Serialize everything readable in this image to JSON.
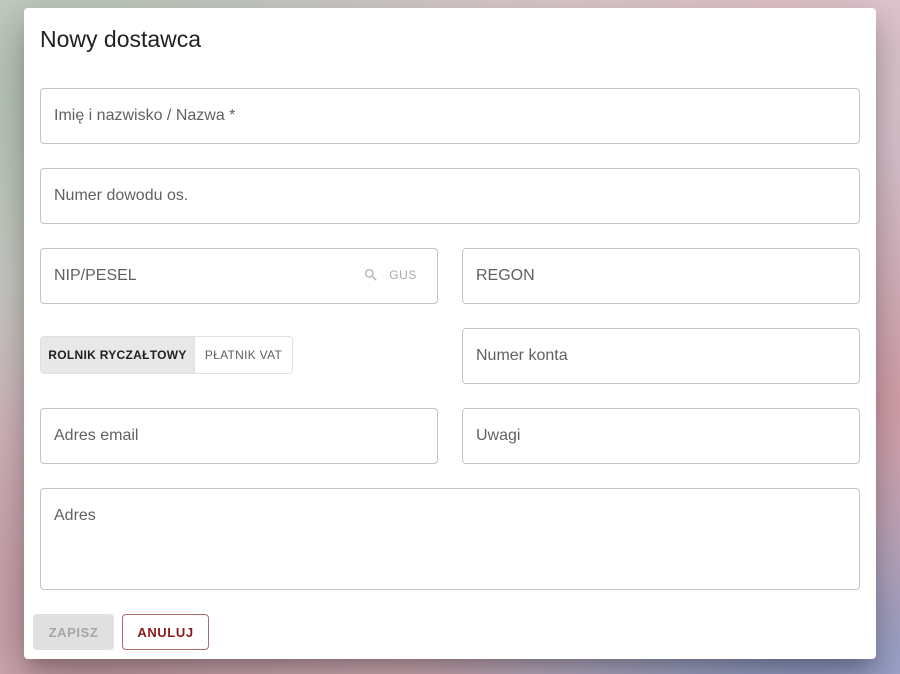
{
  "dialog": {
    "title": "Nowy dostawca"
  },
  "fields": {
    "name": {
      "label": "Imię i nazwisko / Nazwa *"
    },
    "id_number": {
      "label": "Numer dowodu os."
    },
    "nip_pesel": {
      "label": "NIP/PESEL",
      "gus_label": "GUS",
      "gus_icon": "search-icon"
    },
    "regon": {
      "label": "REGON"
    },
    "account_number": {
      "label": "Numer konta"
    },
    "email": {
      "label": "Adres email"
    },
    "notes": {
      "label": "Uwagi"
    },
    "address": {
      "label": "Adres"
    }
  },
  "tax_type": {
    "options": [
      "ROLNIK RYCZAŁTOWY",
      "PŁATNIK VAT"
    ],
    "selected": "ROLNIK RYCZAŁTOWY"
  },
  "actions": {
    "save_label": "ZAPISZ",
    "cancel_label": "ANULUJ"
  },
  "colors": {
    "cancel_accent": "#8b1a1a",
    "disabled_bg": "#e0e0e0",
    "border": "#c4c4c4"
  }
}
